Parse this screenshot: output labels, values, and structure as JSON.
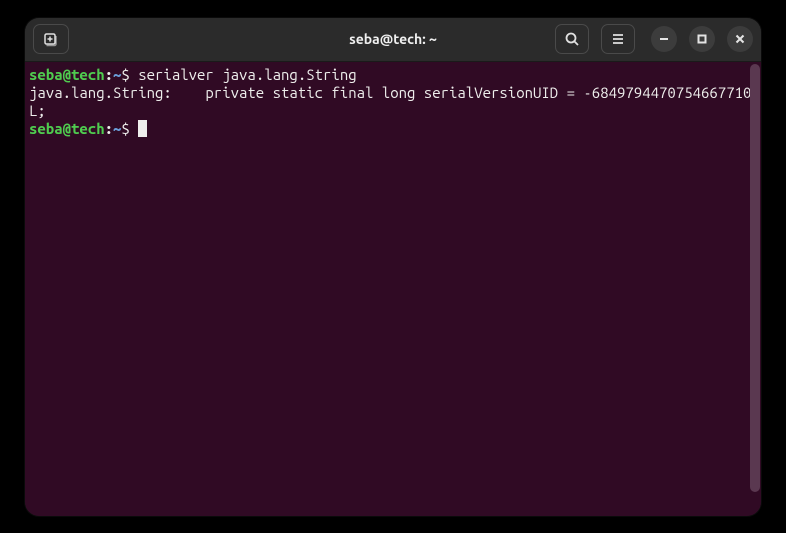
{
  "titlebar": {
    "title": "seba@tech: ~"
  },
  "terminal": {
    "lines": [
      {
        "type": "prompt",
        "user": "seba@tech",
        "colon": ":",
        "path": "~",
        "dollar": "$ ",
        "command": "serialver java.lang.String"
      },
      {
        "type": "output",
        "text": "java.lang.String:    private static final long serialVersionUID = -6849794470754667710L;"
      },
      {
        "type": "prompt",
        "user": "seba@tech",
        "colon": ":",
        "path": "~",
        "dollar": "$ ",
        "command": "",
        "cursor": true
      }
    ]
  }
}
